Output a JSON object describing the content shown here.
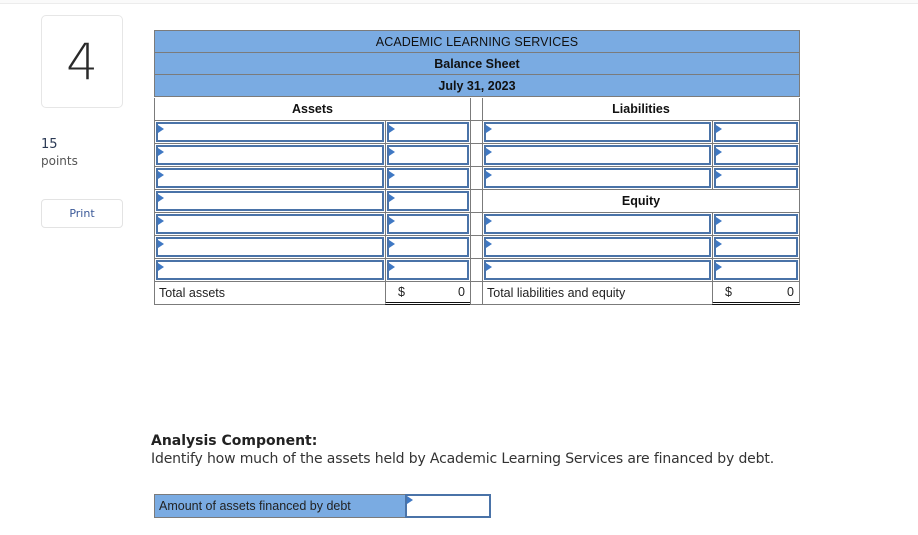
{
  "question": {
    "number": "4",
    "points_value": "15",
    "points_label": "points",
    "print_label": "Print"
  },
  "balance_sheet": {
    "company": "ACADEMIC LEARNING SERVICES",
    "statement": "Balance Sheet",
    "date": "July 31, 2023",
    "assets_header": "Assets",
    "liabilities_header": "Liabilities",
    "equity_header": "Equity",
    "asset_rows": [
      {
        "label": "",
        "amount": ""
      },
      {
        "label": "",
        "amount": ""
      },
      {
        "label": "",
        "amount": ""
      },
      {
        "label": "",
        "amount": ""
      },
      {
        "label": "",
        "amount": ""
      },
      {
        "label": "",
        "amount": ""
      },
      {
        "label": "",
        "amount": ""
      }
    ],
    "liability_rows": [
      {
        "label": "",
        "amount": ""
      },
      {
        "label": "",
        "amount": ""
      },
      {
        "label": "",
        "amount": ""
      }
    ],
    "equity_rows": [
      {
        "label": "",
        "amount": ""
      },
      {
        "label": "",
        "amount": ""
      },
      {
        "label": "",
        "amount": ""
      }
    ],
    "total_assets_label": "Total assets",
    "total_assets_currency": "$",
    "total_assets_value": "0",
    "total_le_label": "Total liabilities and equity",
    "total_le_currency": "$",
    "total_le_value": "0"
  },
  "analysis": {
    "title": "Analysis Component:",
    "instruction": "Identify how much of the assets held by Academic Learning Services are financed by debt.",
    "debt_label": "Amount of assets financed by debt",
    "debt_value": ""
  },
  "colors": {
    "header_fill": "#7aabe2",
    "input_border": "#4a73a8",
    "cell_border": "#7b7b7b"
  }
}
